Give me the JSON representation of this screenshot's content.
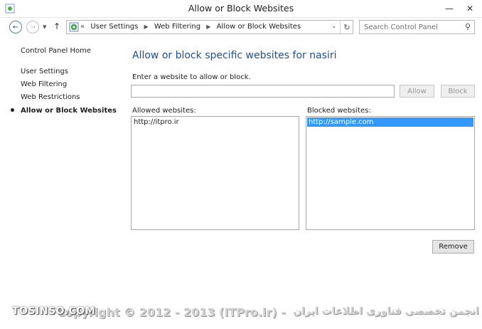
{
  "window": {
    "title": "Allow or Block Websites",
    "controls": {
      "minimize": "—",
      "close": "✕"
    }
  },
  "navigation": {
    "breadcrumb_prefix": "«",
    "breadcrumbs": [
      "User Settings",
      "Web Filtering",
      "Allow or Block Websites"
    ],
    "search_placeholder": "Search Control Panel"
  },
  "left_pane": {
    "home": "Control Panel Home",
    "items": [
      "User Settings",
      "Web Filtering",
      "Web Restrictions",
      "Allow or Block Websites"
    ],
    "current_index": 3
  },
  "main": {
    "heading": "Allow or block specific websites for nasiri",
    "input_label": "Enter a website to allow or block.",
    "input_value": "",
    "allow_button": "Allow",
    "block_button": "Block",
    "allowed_label": "Allowed websites:",
    "allowed_sites": [
      "http://itpro.ir"
    ],
    "blocked_label": "Blocked websites:",
    "blocked_sites": [
      "http://sample.com"
    ],
    "blocked_selected_index": 0,
    "remove_button": "Remove"
  },
  "watermark": {
    "site": "TOSINSO.COM",
    "copyright": "Copyright © 2012 - 2013 (ITPro.ir) -",
    "persian": "انجمن تخصصی فناوری اطلاعات ایران"
  },
  "colors": {
    "heading": "#1f4e99",
    "selection": "#3399ff"
  }
}
